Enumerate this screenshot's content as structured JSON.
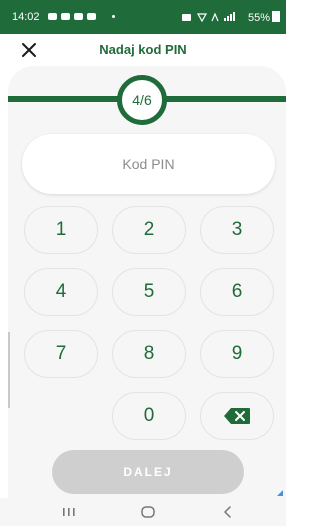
{
  "status_bar": {
    "time": "14:02",
    "right_text": "✉       55%"
  },
  "header": {
    "title": "Nadaj kod PIN",
    "close_icon": "close-icon"
  },
  "progress": {
    "label": "4/6",
    "current": 4,
    "total": 6
  },
  "pin_input": {
    "placeholder": "Kod PIN"
  },
  "keypad": {
    "keys": [
      "1",
      "2",
      "3",
      "4",
      "5",
      "6",
      "7",
      "8",
      "9",
      "",
      "0",
      "backspace"
    ],
    "backspace_icon": "backspace-icon"
  },
  "next_button": {
    "label": "DALEJ",
    "enabled": false
  },
  "nav_bar": {
    "recent_icon": "recent-apps-icon",
    "home_icon": "home-icon",
    "back_icon": "back-icon"
  },
  "colors": {
    "brand_green": "#1f6b3a",
    "card_background": "#f6f6f6",
    "disabled_button": "#cfcfcf",
    "placeholder_gray": "#8c8c8c"
  }
}
